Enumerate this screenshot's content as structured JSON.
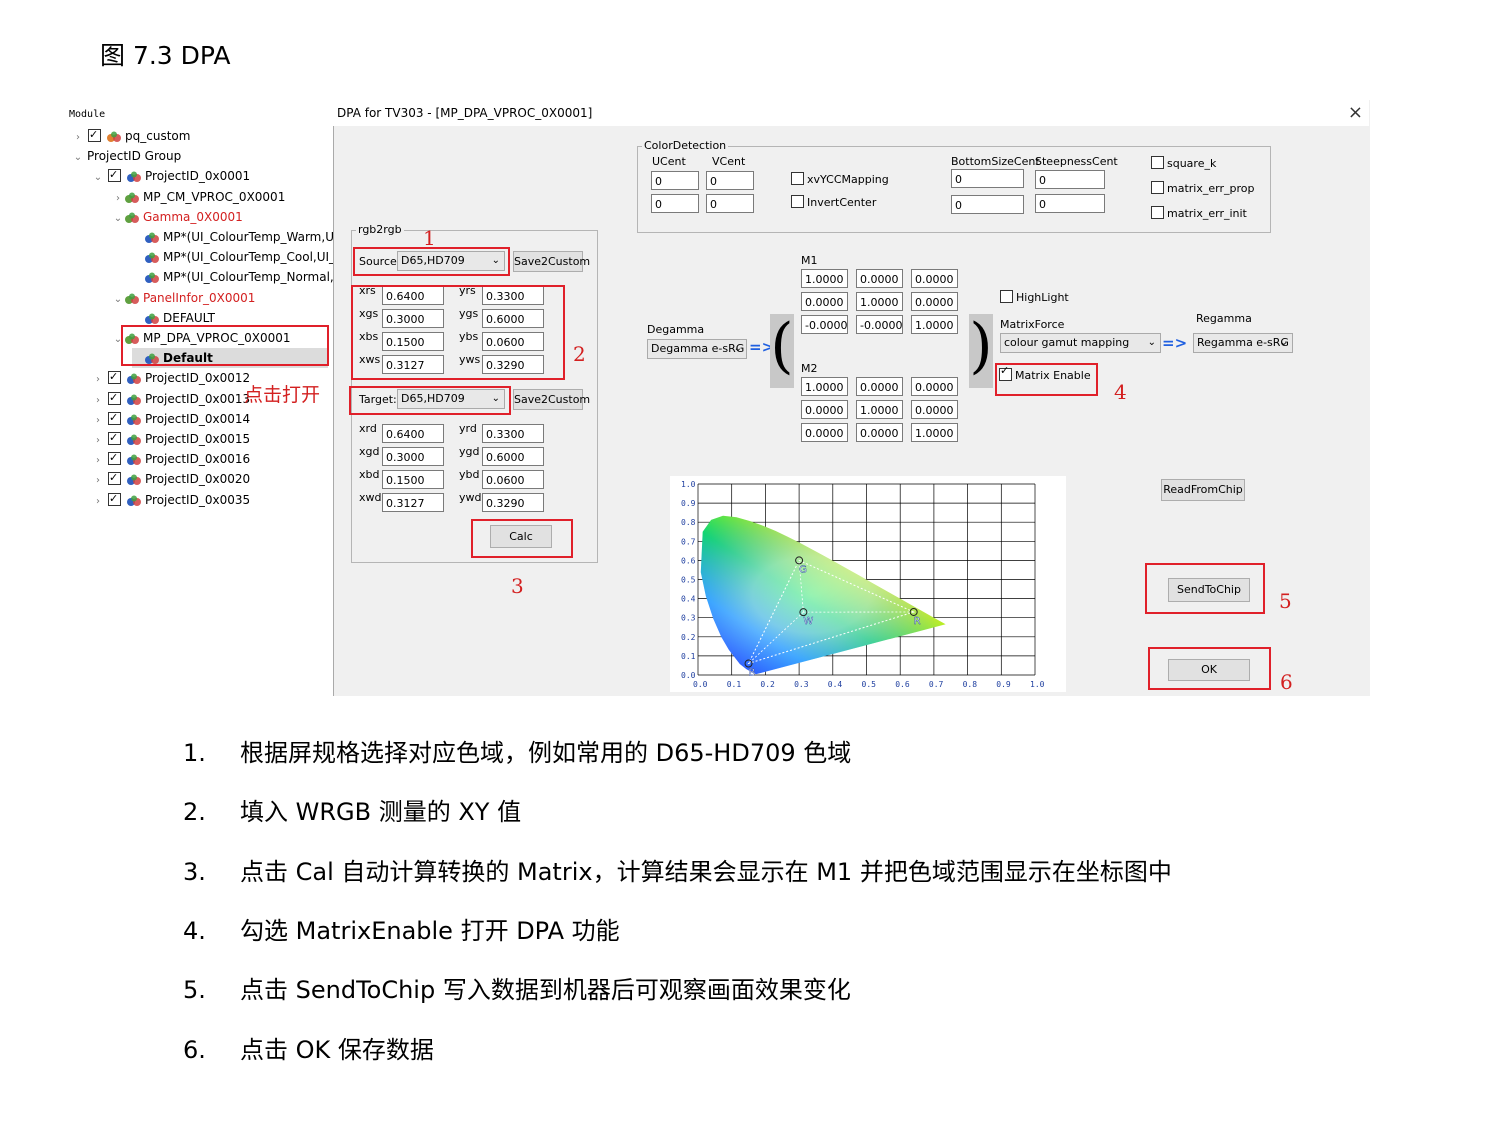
{
  "figure_title": "图 7.3 DPA",
  "tree": {
    "header": "Module",
    "items": [
      {
        "label": "pq_custom",
        "red": false
      },
      {
        "label": "ProjectID Group",
        "red": false
      },
      {
        "label": "ProjectID_0x0001",
        "red": false
      },
      {
        "label": "MP_CM_VPROC_0X0001",
        "red": false
      },
      {
        "label": "Gamma_0X0001",
        "red": true
      },
      {
        "label": "MP*(UI_ColourTemp_Warm,UI",
        "red": false
      },
      {
        "label": "MP*(UI_ColourTemp_Cool,UI_",
        "red": false
      },
      {
        "label": "MP*(UI_ColourTemp_Normal,(",
        "red": false
      },
      {
        "label": "PanelInfor_0X0001",
        "red": true
      },
      {
        "label": "DEFAULT",
        "red": false
      },
      {
        "label": "MP_DPA_VPROC_0X0001",
        "red": false
      },
      {
        "label": "Default",
        "red": false
      },
      {
        "label": "ProjectID_0x0012",
        "red": false
      },
      {
        "label": "ProjectID_0x0013",
        "red": false
      },
      {
        "label": "ProjectID_0x0014",
        "red": false
      },
      {
        "label": "ProjectID_0x0015",
        "red": false
      },
      {
        "label": "ProjectID_0x0016",
        "red": false
      },
      {
        "label": "ProjectID_0x0020",
        "red": false
      },
      {
        "label": "ProjectID_0x0035",
        "red": false
      }
    ],
    "annotation": "点击打开"
  },
  "dialog": {
    "title": "DPA for TV303 - [MP_DPA_VPROC_0X0001]",
    "close": "×",
    "color_detection": {
      "title": "ColorDetection",
      "ucent_label": "UCent",
      "vcent_label": "VCent",
      "ucent": [
        "0",
        "0"
      ],
      "vcent": [
        "0",
        "0"
      ],
      "xvycc_label": "xvYCCMapping",
      "invert_label": "InvertCenter",
      "bottom_label": "BottomSizeCent",
      "steep_label": "SteepnessCent",
      "bottom": [
        "0",
        "0"
      ],
      "steep": [
        "0",
        "0"
      ],
      "square_k": "square_k",
      "matrix_err_prop": "matrix_err_prop",
      "matrix_err_init": "matrix_err_init"
    },
    "rgb2rgb": {
      "title": "rgb2rgb",
      "source_label": "Source",
      "source_value": "D65,HD709",
      "target_label": "Target:",
      "target_value": "D65,HD709",
      "save_label": "Save2Custom",
      "source_rows": [
        {
          "l1": "xrs",
          "v1": "0.6400",
          "l2": "yrs",
          "v2": "0.3300"
        },
        {
          "l1": "xgs",
          "v1": "0.3000",
          "l2": "ygs",
          "v2": "0.6000"
        },
        {
          "l1": "xbs",
          "v1": "0.1500",
          "l2": "ybs",
          "v2": "0.0600"
        },
        {
          "l1": "xws",
          "v1": "0.3127",
          "l2": "yws",
          "v2": "0.3290"
        }
      ],
      "target_rows": [
        {
          "l1": "xrd",
          "v1": "0.6400",
          "l2": "yrd",
          "v2": "0.3300"
        },
        {
          "l1": "xgd",
          "v1": "0.3000",
          "l2": "ygd",
          "v2": "0.6000"
        },
        {
          "l1": "xbd",
          "v1": "0.1500",
          "l2": "ybd",
          "v2": "0.0600"
        },
        {
          "l1": "xwd",
          "v1": "0.3127",
          "l2": "ywd",
          "v2": "0.3290"
        }
      ],
      "calc_label": "Calc"
    },
    "degamma_label": "Degamma",
    "degamma_value": "Degamma e-sRG",
    "regamma_label": "Regamma",
    "regamma_value": "Regamma e-sRG",
    "m1_label": "M1",
    "m1": [
      "1.0000",
      "0.0000",
      "0.0000",
      "0.0000",
      "1.0000",
      "0.0000",
      "-0.0000",
      "-0.0000",
      "1.0000"
    ],
    "m2_label": "M2",
    "m2": [
      "1.0000",
      "0.0000",
      "0.0000",
      "0.0000",
      "1.0000",
      "0.0000",
      "0.0000",
      "0.0000",
      "1.0000"
    ],
    "highlight_label": "HighLight",
    "matrixforce_label": "MatrixForce",
    "matrixforce_value": "colour gamut mapping",
    "matrix_enable_label": "Matrix Enable",
    "readfromchip_label": "ReadFromChip",
    "sendtochip_label": "SendToChip",
    "ok_label": "OK",
    "chart_axis_labels": [
      "0.0",
      "0.1",
      "0.2",
      "0.3",
      "0.4",
      "0.5",
      "0.6",
      "0.7",
      "0.8",
      "0.9",
      "1.0"
    ],
    "chart_points": {
      "r": "R",
      "g": "G",
      "b": "B",
      "w": "W"
    },
    "callouts": [
      "1",
      "2",
      "3",
      "4",
      "5",
      "6"
    ]
  },
  "chart_data": {
    "type": "scatter",
    "title": "",
    "xlabel": "",
    "ylabel": "",
    "xlim": [
      0,
      1
    ],
    "ylim": [
      0,
      1
    ],
    "grid": true,
    "series": [
      {
        "name": "",
        "x": [
          0.64,
          0.3,
          0.15,
          0.3127
        ],
        "y": [
          0.33,
          0.6,
          0.06,
          0.329
        ],
        "labels": [
          "R",
          "G",
          "B",
          "W"
        ]
      }
    ]
  },
  "list": [
    {
      "num": "1.",
      "text": "根据屏规格选择对应色域，例如常用的 D65-HD709 色域"
    },
    {
      "num": "2.",
      "text": "填入 WRGB 测量的 XY 值"
    },
    {
      "num": "3.",
      "text": "点击 Cal 自动计算转换的 Matrix，计算结果会显示在 M1 并把色域范围显示在坐标图中"
    },
    {
      "num": "4.",
      "text": "勾选 MatrixEnable 打开 DPA 功能"
    },
    {
      "num": "5.",
      "text": "点击 SendToChip 写入数据到机器后可观察画面效果变化"
    },
    {
      "num": "6.",
      "text": "点击 OK 保存数据"
    }
  ]
}
